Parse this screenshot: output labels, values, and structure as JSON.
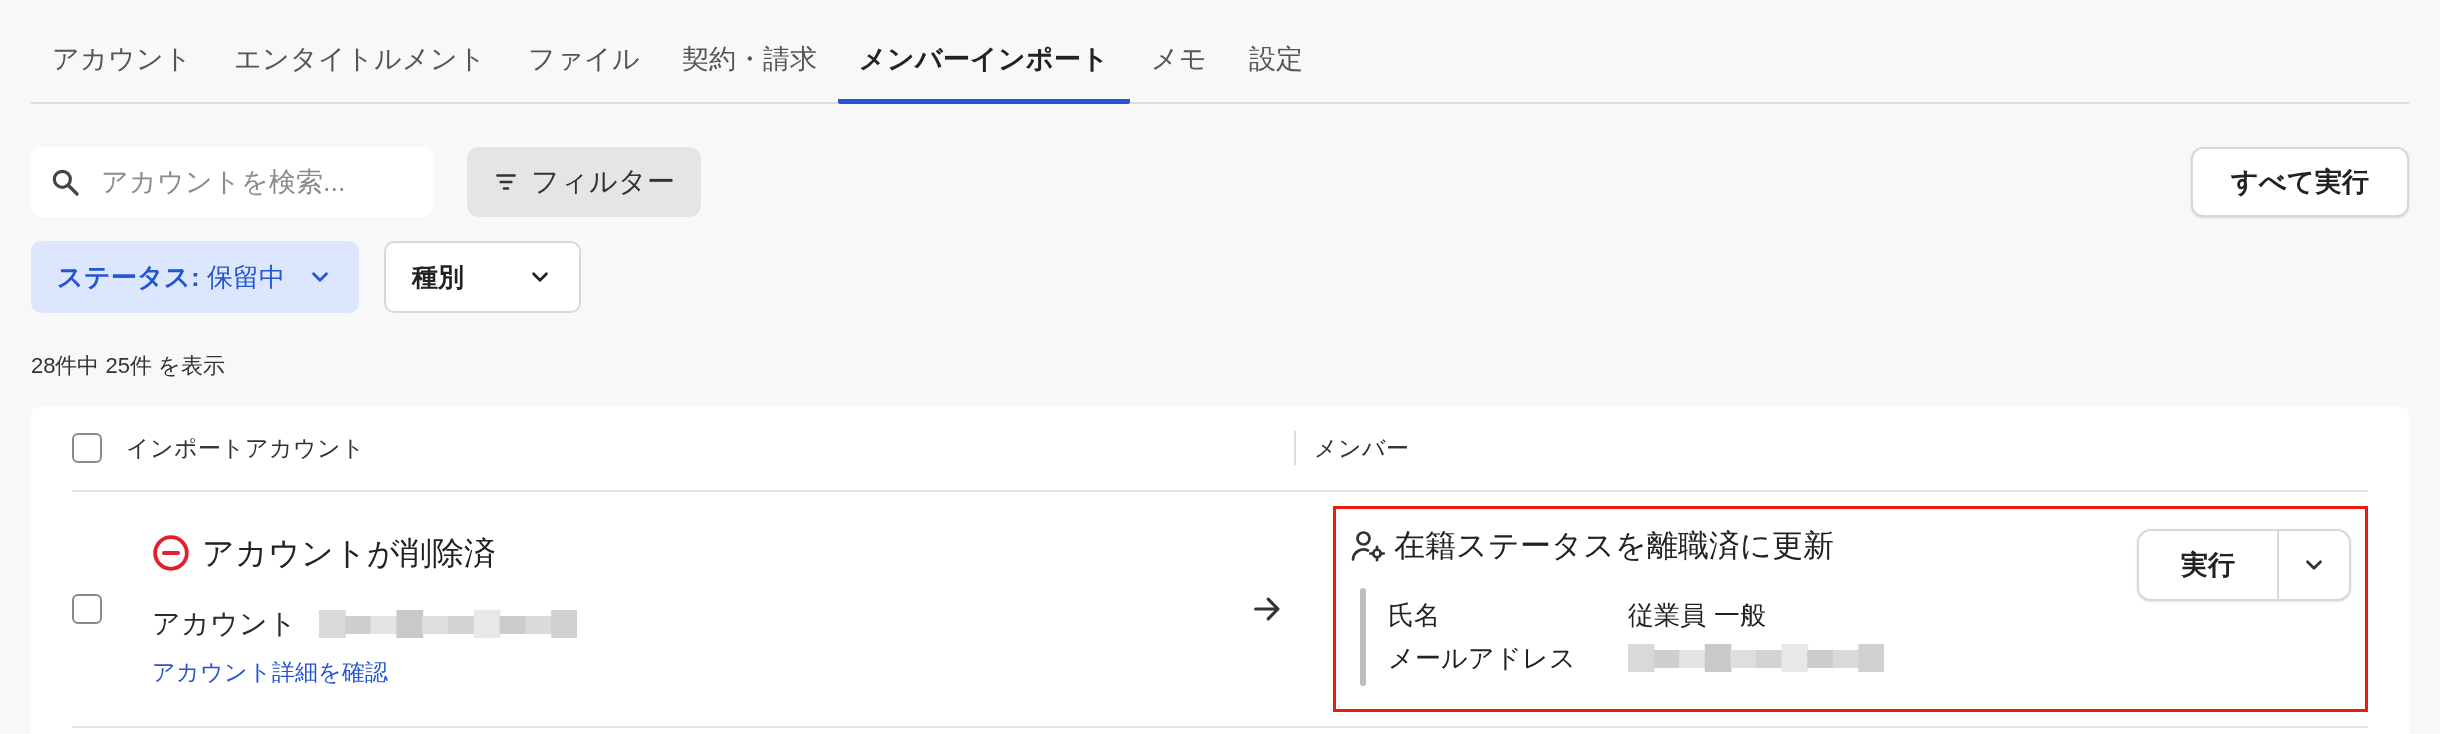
{
  "tabs": [
    {
      "label": "アカウント",
      "selected": false
    },
    {
      "label": "エンタイトルメント",
      "selected": false
    },
    {
      "label": "ファイル",
      "selected": false
    },
    {
      "label": "契約・請求",
      "selected": false
    },
    {
      "label": "メンバーインポート",
      "selected": true
    },
    {
      "label": "メモ",
      "selected": false
    },
    {
      "label": "設定",
      "selected": false
    }
  ],
  "search": {
    "placeholder": "アカウントを検索..."
  },
  "filter_button": {
    "label": "フィルター"
  },
  "run_all_button": {
    "label": "すべて実行"
  },
  "filters": [
    {
      "label": "ステータス:",
      "value": "保留中",
      "active": true
    },
    {
      "label": "種別",
      "active": false
    }
  ],
  "count": "28件中 25件 を表示",
  "table": {
    "select_all": {
      "checked": false
    },
    "columns": [
      "インポートアカウント",
      "メンバー"
    ],
    "rows": [
      {
        "checked": false,
        "status": "アカウントが削除済",
        "account_label": "アカウント",
        "link": "アカウント詳細を確認",
        "action": {
          "title": "在籍ステータスを離職済に更新",
          "highlighted": true,
          "button": "実行",
          "fields": [
            {
              "label": "氏名",
              "value": "従業員 一般"
            },
            {
              "label": "メールアドレス"
            }
          ]
        }
      }
    ]
  }
}
